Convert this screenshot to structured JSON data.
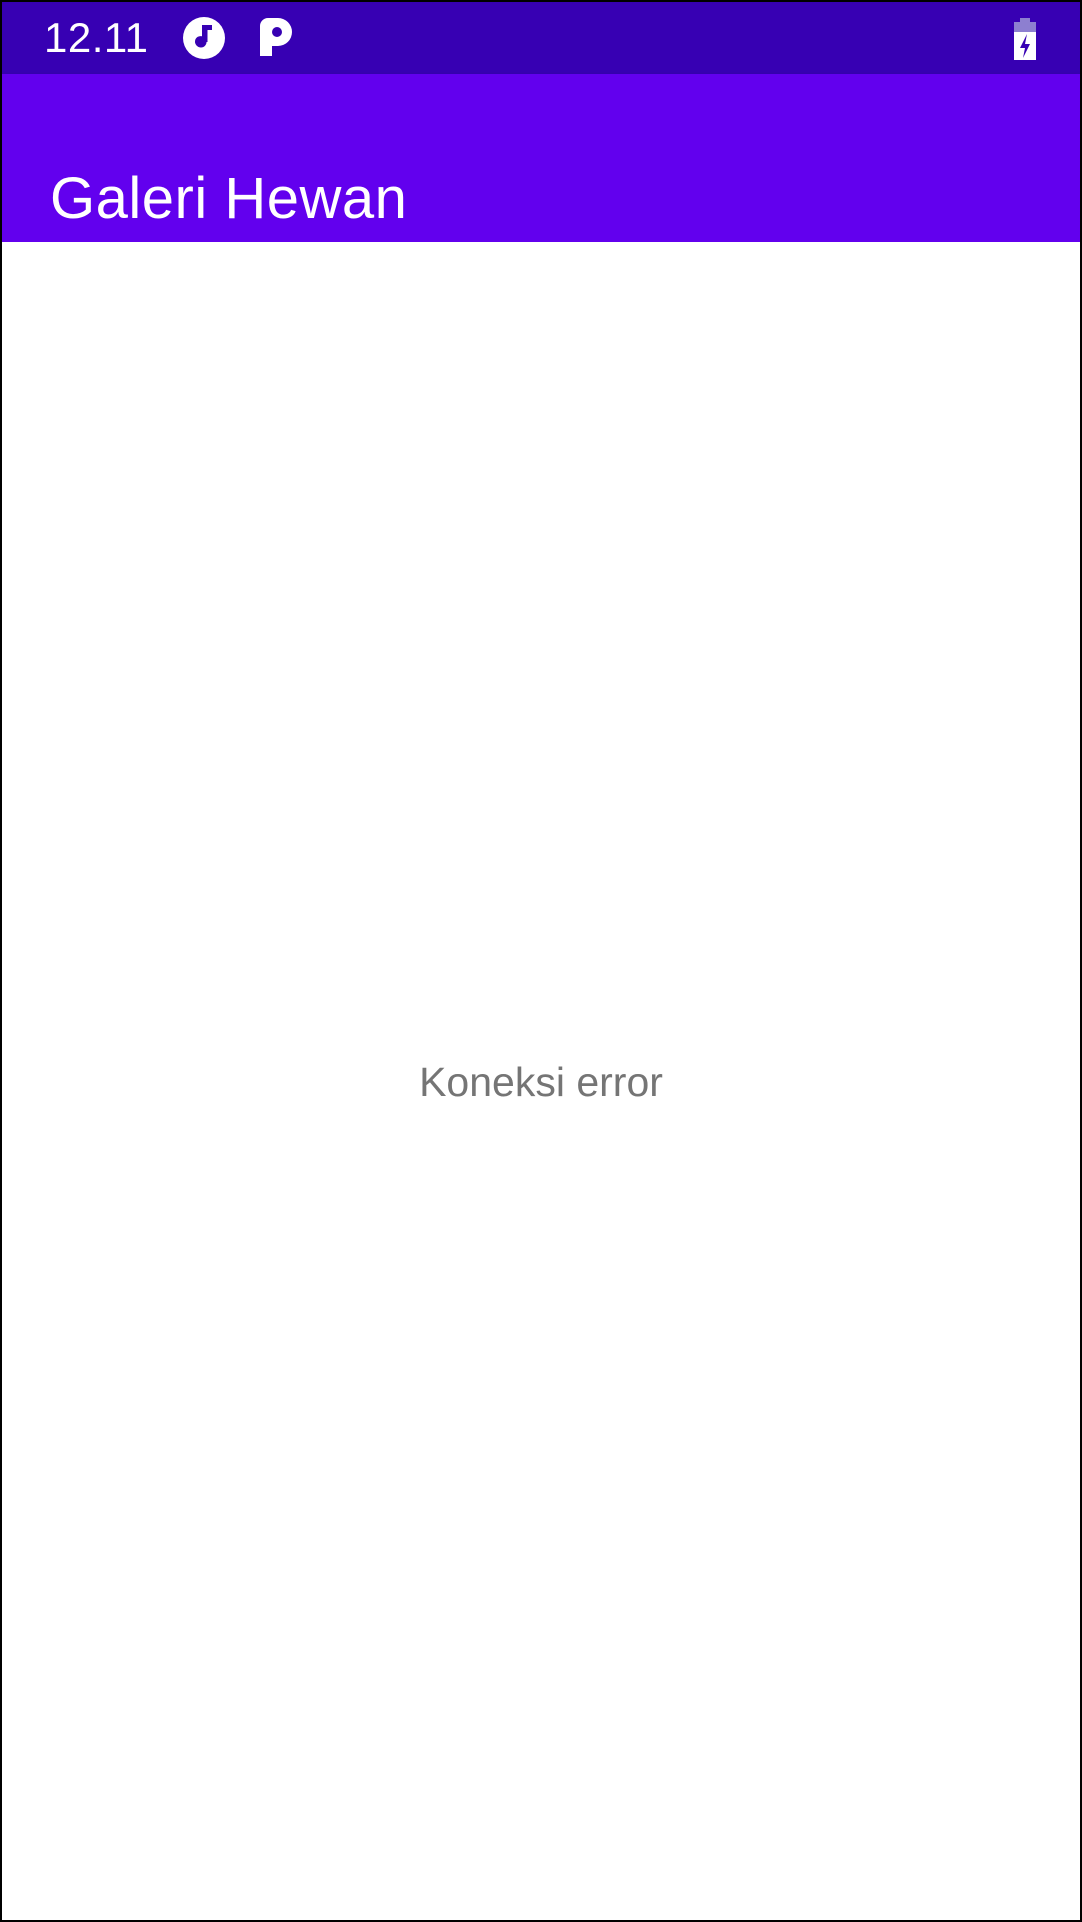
{
  "status_bar": {
    "time": "12.11",
    "icons": [
      "music-note-icon",
      "p-app-icon",
      "battery-charging-icon"
    ],
    "background_color": "#3700B3"
  },
  "app_bar": {
    "title": "Galeri Hewan",
    "background_color": "#6200EE"
  },
  "content": {
    "message": "Koneksi error",
    "message_color": "#757575"
  }
}
